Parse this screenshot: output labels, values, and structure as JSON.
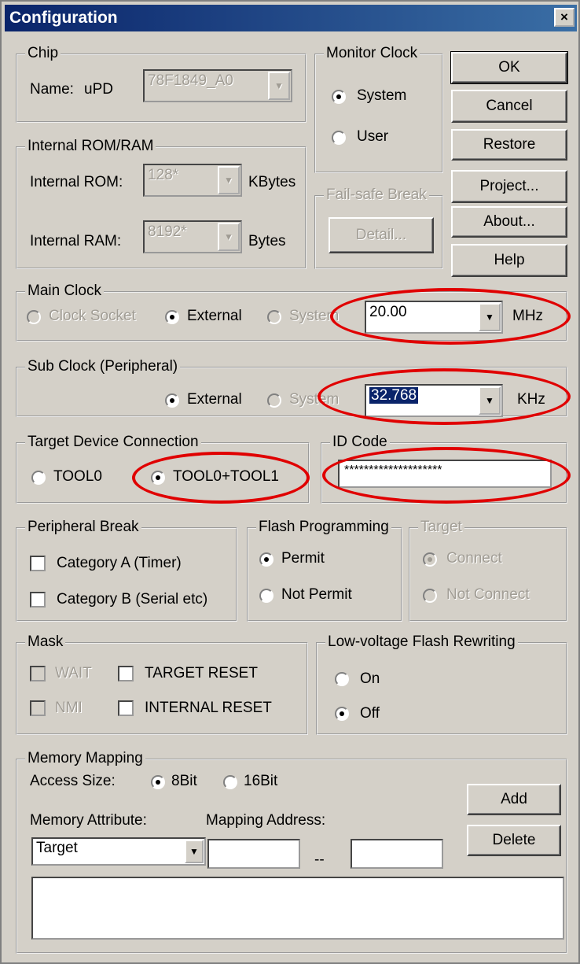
{
  "window": {
    "title": "Configuration",
    "close": "×"
  },
  "chip": {
    "group": "Chip",
    "name_label": "Name:",
    "name_prefix": "uPD",
    "name_value": "78F1849_A0"
  },
  "monitor_clock": {
    "group": "Monitor Clock",
    "system": "System",
    "user": "User",
    "selected": "System"
  },
  "buttons": {
    "ok": "OK",
    "cancel": "Cancel",
    "restore": "Restore",
    "project": "Project...",
    "about": "About...",
    "help": "Help"
  },
  "rom_ram": {
    "group": "Internal ROM/RAM",
    "rom_label": "Internal ROM:",
    "rom_value": "128*",
    "rom_unit": "KBytes",
    "ram_label": "Internal RAM:",
    "ram_value": "8192*",
    "ram_unit": "Bytes"
  },
  "fail_safe": {
    "group": "Fail-safe Break",
    "detail": "Detail..."
  },
  "main_clock": {
    "group": "Main Clock",
    "clock_socket": "Clock Socket",
    "external": "External",
    "system": "System",
    "value": "20.00",
    "unit": "MHz"
  },
  "sub_clock": {
    "group": "Sub Clock (Peripheral)",
    "external": "External",
    "system": "System",
    "value": "32.768",
    "unit": "KHz"
  },
  "target_connection": {
    "group": "Target Device Connection",
    "tool0": "TOOL0",
    "tool01": "TOOL0+TOOL1",
    "selected": "TOOL0+TOOL1"
  },
  "id_code": {
    "group": "ID Code",
    "value": "********************"
  },
  "peripheral_break": {
    "group": "Peripheral Break",
    "cat_a": "Category A (Timer)",
    "cat_b": "Category B (Serial etc)"
  },
  "flash_programming": {
    "group": "Flash Programming",
    "permit": "Permit",
    "not_permit": "Not Permit",
    "selected": "Permit"
  },
  "target": {
    "group": "Target",
    "connect": "Connect",
    "not_connect": "Not Connect"
  },
  "mask": {
    "group": "Mask",
    "wait": "WAIT",
    "target_reset": "TARGET RESET",
    "nmi": "NMI",
    "internal_reset": "INTERNAL RESET"
  },
  "low_voltage": {
    "group": "Low-voltage Flash Rewriting",
    "on": "On",
    "off": "Off",
    "selected": "Off"
  },
  "memory_mapping": {
    "group": "Memory Mapping",
    "access_label": "Access Size:",
    "bit8": "8Bit",
    "bit16": "16Bit",
    "attr_label": "Memory Attribute:",
    "addr_label": "Mapping Address:",
    "attr_value": "Target",
    "separator": "--",
    "add": "Add",
    "delete": "Delete"
  },
  "colors": {
    "face": "#d4d0c8",
    "title": "#0a246a",
    "highlight": "#e00000"
  }
}
